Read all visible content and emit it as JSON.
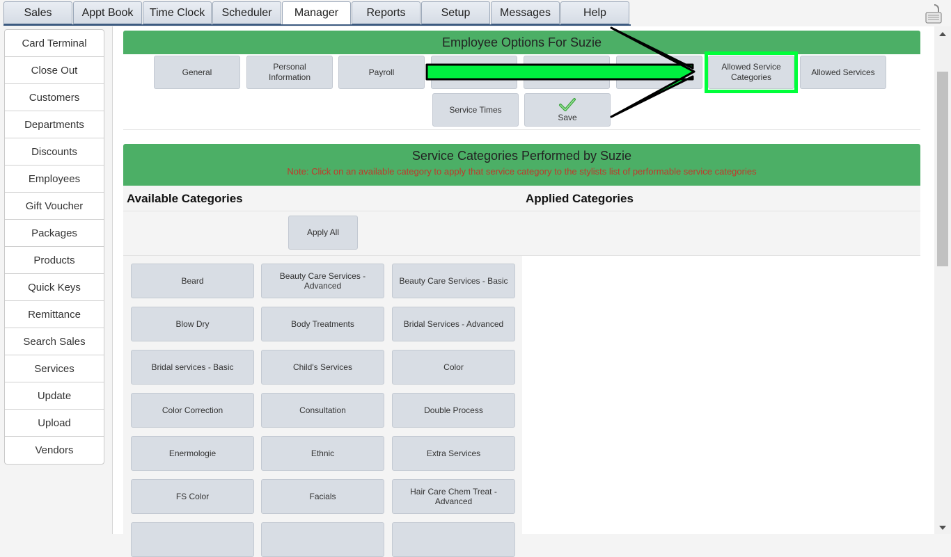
{
  "top_tabs": [
    {
      "label": "Sales"
    },
    {
      "label": "Appt Book"
    },
    {
      "label": "Time Clock"
    },
    {
      "label": "Scheduler"
    },
    {
      "label": "Manager",
      "active": true
    },
    {
      "label": "Reports"
    },
    {
      "label": "Setup"
    },
    {
      "label": "Messages"
    },
    {
      "label": "Help"
    }
  ],
  "sidebar": {
    "items": [
      {
        "label": "Card Terminal"
      },
      {
        "label": "Close Out"
      },
      {
        "label": "Customers"
      },
      {
        "label": "Departments"
      },
      {
        "label": "Discounts"
      },
      {
        "label": "Employees"
      },
      {
        "label": "Gift Voucher"
      },
      {
        "label": "Packages"
      },
      {
        "label": "Products"
      },
      {
        "label": "Quick Keys"
      },
      {
        "label": "Remittance"
      },
      {
        "label": "Search Sales"
      },
      {
        "label": "Services"
      },
      {
        "label": "Update"
      },
      {
        "label": "Upload"
      },
      {
        "label": "Vendors"
      }
    ]
  },
  "employee_options": {
    "title": "Employee Options For Suzie",
    "buttons": {
      "general": "General",
      "personal_information": "Personal Information",
      "payroll": "Payroll",
      "allowed_service_categories": "Allowed Service Categories",
      "allowed_services": "Allowed Services",
      "service_times": "Service Times",
      "save": "Save"
    }
  },
  "service_categories": {
    "title": "Service Categories Performed by Suzie",
    "note": "Note: Click on an available category to apply that service category to the stylists list of performable service categories",
    "available_heading": "Available Categories",
    "applied_heading": "Applied Categories",
    "apply_all": "Apply All",
    "available": [
      "Beard",
      "Beauty Care Services - Advanced",
      "Beauty Care Services - Basic",
      "Blow Dry",
      "Body Treatments",
      "Bridal Services - Advanced",
      "Bridal services - Basic",
      "Child's Services",
      "Color",
      "Color Correction",
      "Consultation",
      "Double Process",
      "Enermologie",
      "Ethnic",
      "Extra Services",
      "FS Color",
      "Facials",
      "Hair Care Chem Treat - Advanced"
    ]
  },
  "icons": {
    "save": "checkmark-icon",
    "lock": "lock-icon",
    "annotation": "green-arrow-annotation"
  },
  "colors": {
    "header_green": "#4caf66",
    "highlight_green": "#00ff3a",
    "note_red": "#c0392b"
  }
}
